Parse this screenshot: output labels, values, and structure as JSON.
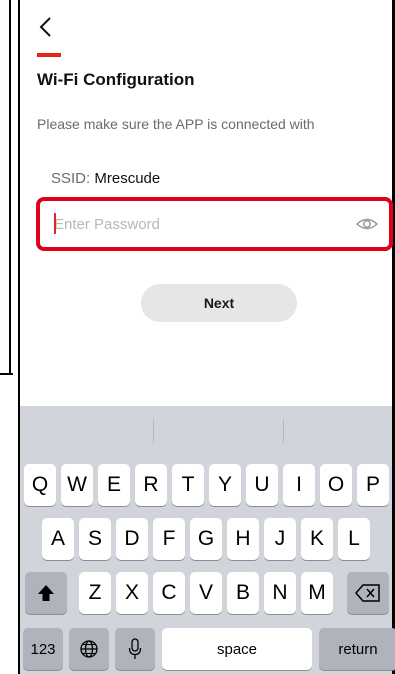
{
  "header": {
    "back_icon": "chevron-left-icon",
    "accent_color": "#e1261c"
  },
  "title": "Wi-Fi Configuration",
  "subtitle": "Please make sure the APP is connected with",
  "ssid": {
    "label": "SSID:",
    "value": "Mrescude"
  },
  "password": {
    "placeholder": "Enter Password",
    "value": "",
    "toggle_icon": "eye-icon"
  },
  "next_button": {
    "label": "Next"
  },
  "keyboard": {
    "row1": [
      "Q",
      "W",
      "E",
      "R",
      "T",
      "Y",
      "U",
      "I",
      "O",
      "P"
    ],
    "row2": [
      "A",
      "S",
      "D",
      "F",
      "G",
      "H",
      "J",
      "K",
      "L"
    ],
    "row3": [
      "Z",
      "X",
      "C",
      "V",
      "B",
      "N",
      "M"
    ],
    "numbers_label": "123",
    "space_label": "space",
    "return_label": "return",
    "shift_icon": "shift-icon",
    "globe_icon": "globe-icon",
    "mic_icon": "microphone-icon",
    "backspace_icon": "backspace-icon"
  }
}
